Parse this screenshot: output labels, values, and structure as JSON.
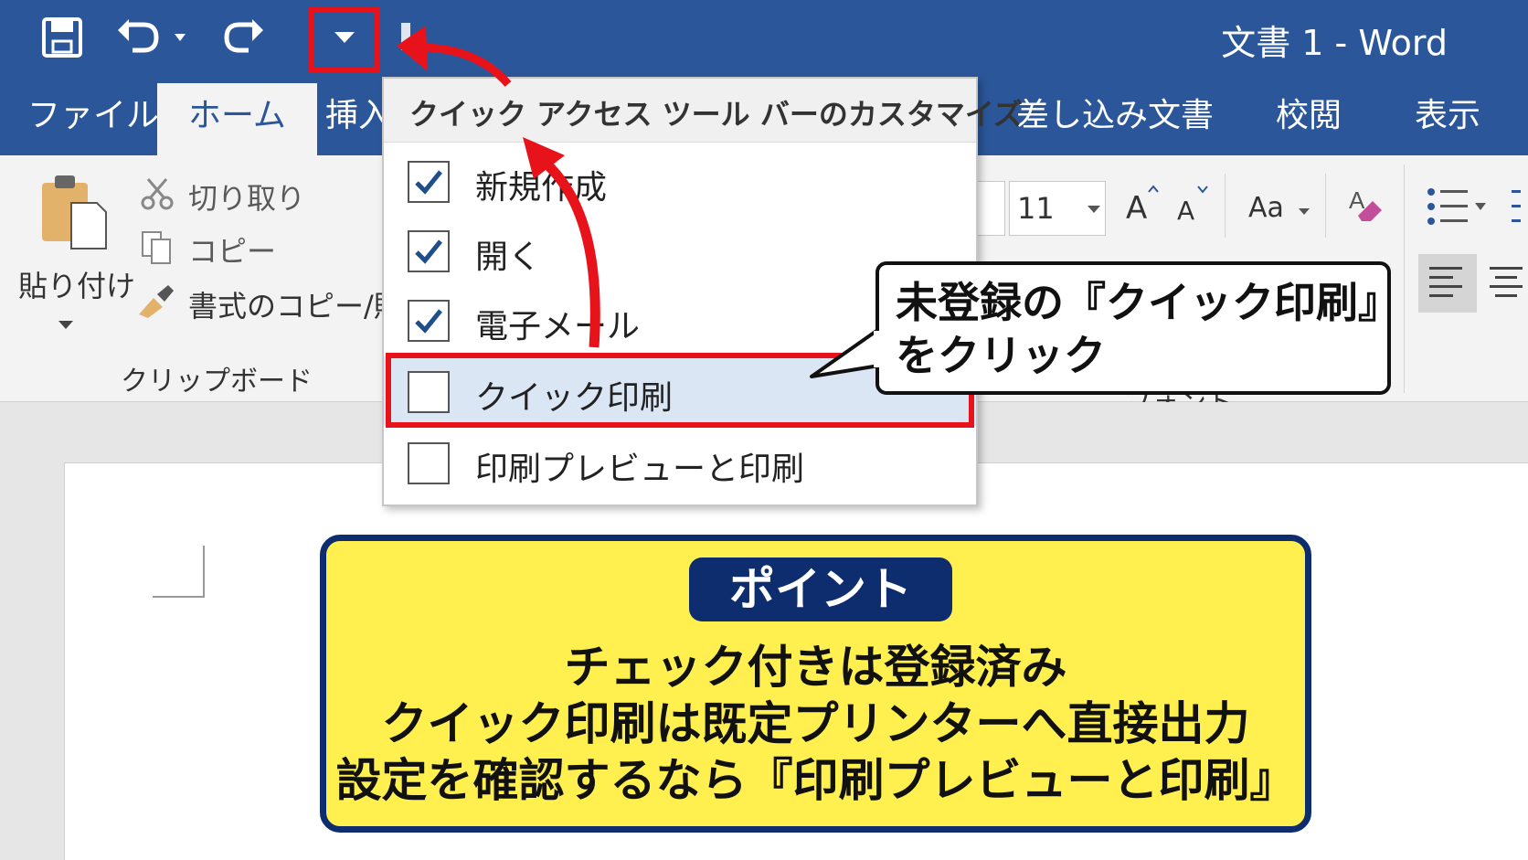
{
  "window": {
    "title": "文書 1  -  Word"
  },
  "tabs": [
    {
      "label": "ファイル",
      "active": false
    },
    {
      "label": "ホーム",
      "active": true
    },
    {
      "label": "挿入",
      "active": false
    },
    {
      "label": "差し込み文書",
      "active": false
    },
    {
      "label": "校閲",
      "active": false
    },
    {
      "label": "表示",
      "active": false
    }
  ],
  "clipboard": {
    "paste_label": "貼り付け",
    "cut_label": "切り取り",
    "copy_label": "コピー",
    "format_painter_label": "書式のコピー/貼り付",
    "group_label": "クリップボード"
  },
  "font": {
    "size_value": "11",
    "grow_label": "A",
    "shrink_label": "A",
    "case_label": "Aa",
    "group_label": "フォント"
  },
  "qat_menu": {
    "title": "クイック アクセス ツール バーのカスタマイズ",
    "items": [
      {
        "label": "新規作成",
        "checked": true
      },
      {
        "label": "開く",
        "checked": true
      },
      {
        "label": "電子メール",
        "checked": true
      },
      {
        "label": "クイック印刷",
        "checked": false
      },
      {
        "label": "印刷プレビューと印刷",
        "checked": false
      }
    ]
  },
  "callout": {
    "line1": "未登録の『クイック印刷』",
    "line2": "をクリック"
  },
  "point": {
    "badge": "ポイント",
    "lines": [
      "チェック付きは登録済み",
      "クイック印刷は既定プリンターへ直接出力",
      "設定を確認するなら『印刷プレビューと印刷』"
    ]
  },
  "colors": {
    "titlebar": "#2b579a",
    "highlight_red": "#e8121a",
    "point_bg": "#fff04f",
    "point_border": "#0e2d6e"
  }
}
